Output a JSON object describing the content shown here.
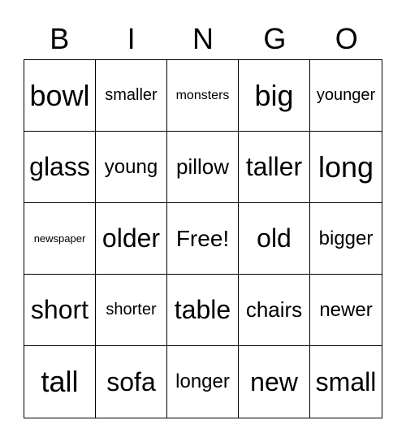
{
  "header": [
    "B",
    "I",
    "N",
    "G",
    "O"
  ],
  "cells": [
    "bowl",
    "smaller",
    "monsters",
    "big",
    "younger",
    "glass",
    "young",
    "pillow",
    "taller",
    "long",
    "newspaper",
    "older",
    "Free!",
    "old",
    "bigger",
    "short",
    "shorter",
    "table",
    "chairs",
    "newer",
    "tall",
    "sofa",
    "longer",
    "new",
    "small"
  ]
}
